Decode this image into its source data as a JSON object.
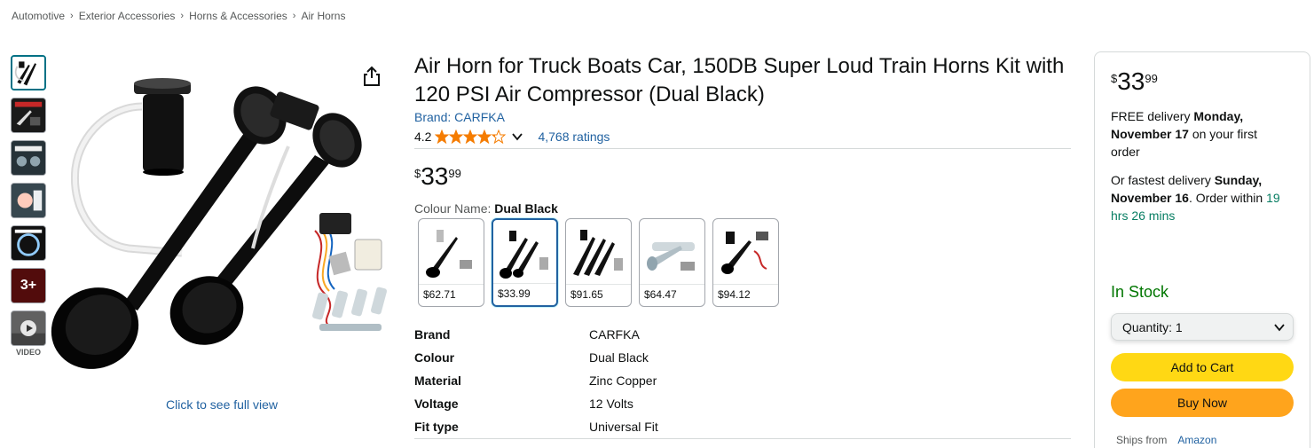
{
  "breadcrumb": [
    "Automotive",
    "Exterior Accessories",
    "Horns & Accessories",
    "Air Horns"
  ],
  "gallery": {
    "thumbnails": [
      "horn-kit",
      "horn-feature",
      "horn-installed",
      "horn-loud",
      "horn-dashboard",
      "more-images",
      "video"
    ],
    "more_count": "3+",
    "video_label": "VIDEO",
    "full_view_link": "Click to see full view"
  },
  "product": {
    "title": "Air Horn for Truck Boats Car, 150DB Super Loud Train Horns Kit with 120 PSI Air Compressor (Dual Black)",
    "brand_link": "Brand: CARFKA",
    "rating": "4.2",
    "stars": 4.2,
    "ratings_count": "4,768 ratings",
    "price": {
      "symbol": "$",
      "whole": "33",
      "fraction": "99"
    },
    "colour_label": "Colour Name:",
    "colour_value": "Dual Black",
    "swatches": [
      {
        "price": "$62.71"
      },
      {
        "price": "$33.99"
      },
      {
        "price": "$91.65"
      },
      {
        "price": "$64.47"
      },
      {
        "price": "$94.12"
      }
    ],
    "specs": [
      {
        "key": "Brand",
        "value": "CARFKA"
      },
      {
        "key": "Colour",
        "value": "Dual Black"
      },
      {
        "key": "Material",
        "value": "Zinc Copper"
      },
      {
        "key": "Voltage",
        "value": "12 Volts"
      },
      {
        "key": "Fit type",
        "value": "Universal Fit"
      }
    ]
  },
  "buybox": {
    "price": {
      "symbol": "$",
      "whole": "33",
      "fraction": "99"
    },
    "delivery_prefix": "FREE delivery ",
    "delivery_date": "Monday, November 17",
    "delivery_suffix": " on your first order",
    "fastest_prefix": "Or fastest delivery ",
    "fastest_date": "Sunday, November 16",
    "fastest_middle": ". Order within ",
    "fastest_time": "19 hrs 26 mins",
    "stock": "In Stock",
    "quantity_label": "Quantity:",
    "quantity_value": "1",
    "add_to_cart": "Add to Cart",
    "buy_now": "Buy Now",
    "ships_from_label": "Ships from",
    "ships_from_value": "Amazon"
  },
  "colors": {
    "link": "#2162a1",
    "add_to_cart": "#ffd814",
    "buy_now": "#ffa41c",
    "in_stock": "#007600",
    "star": "#f57c00"
  }
}
